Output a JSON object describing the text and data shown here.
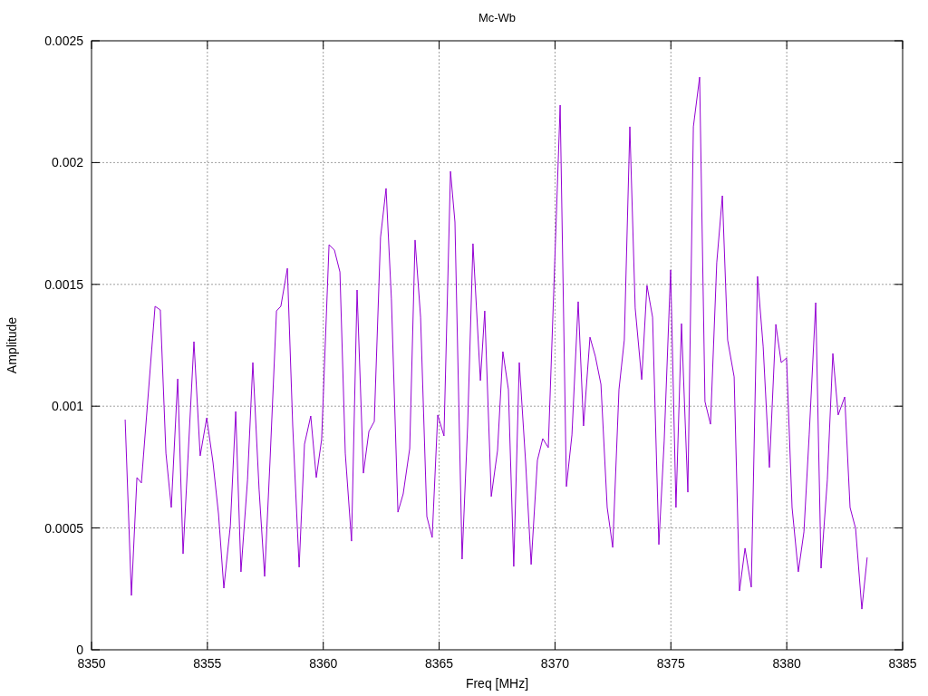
{
  "chart_data": {
    "type": "line",
    "title": "Mc-Wb",
    "xlabel": "Freq [MHz]",
    "ylabel": "Amplitude",
    "x": [
      8351.45,
      8351.72,
      8351.96,
      8352.15,
      8352.74,
      8352.97,
      8353.21,
      8353.44,
      8353.72,
      8353.95,
      8354.42,
      8354.69,
      8354.97,
      8355.24,
      8355.48,
      8355.71,
      8355.99,
      8356.22,
      8356.45,
      8356.73,
      8356.96,
      8357.23,
      8357.47,
      8357.7,
      8357.98,
      8358.17,
      8358.45,
      8358.68,
      8358.96,
      8359.19,
      8359.46,
      8359.7,
      8359.93,
      8360.25,
      8360.48,
      8360.72,
      8360.95,
      8361.22,
      8361.46,
      8361.73,
      8361.97,
      8362.2,
      8362.47,
      8362.71,
      8362.94,
      8363.22,
      8363.45,
      8363.73,
      8363.96,
      8364.2,
      8364.47,
      8364.7,
      8364.94,
      8365.21,
      8365.49,
      8365.68,
      8365.99,
      8366.23,
      8366.46,
      8366.78,
      8366.97,
      8367.25,
      8367.52,
      8367.75,
      8367.99,
      8368.22,
      8368.46,
      8368.73,
      8368.97,
      8369.24,
      8369.47,
      8369.71,
      8369.94,
      8370.22,
      8370.49,
      8370.73,
      8371.0,
      8371.23,
      8371.51,
      8371.74,
      8371.98,
      8372.25,
      8372.49,
      8372.76,
      8372.99,
      8373.23,
      8373.46,
      8373.74,
      8373.97,
      8374.21,
      8374.48,
      8374.71,
      8374.99,
      8375.22,
      8375.46,
      8375.73,
      8375.97,
      8376.24,
      8376.47,
      8376.71,
      8376.98,
      8377.22,
      8377.45,
      8377.73,
      8377.96,
      8378.2,
      8378.47,
      8378.74,
      8378.98,
      8379.25,
      8379.53,
      8379.76,
      8379.99,
      8380.23,
      8380.5,
      8380.74,
      8380.97,
      8381.25,
      8381.48,
      8381.75,
      8381.99,
      8382.22,
      8382.5,
      8382.73,
      8382.97,
      8383.24,
      8383.47
    ],
    "series": [
      {
        "color": "#9400d3",
        "values": [
          0.000945,
          0.000223,
          0.000707,
          0.000685,
          0.00141,
          0.001395,
          0.000807,
          0.000584,
          0.001112,
          0.000394,
          0.001265,
          0.000796,
          0.000952,
          0.00077,
          0.000558,
          0.000253,
          0.00051,
          0.000978,
          0.00032,
          0.000696,
          0.001179,
          0.000658,
          0.000301,
          0.00077,
          0.001391,
          0.00141,
          0.001566,
          0.000919,
          0.000339,
          0.000844,
          0.00096,
          0.000707,
          0.000863,
          0.001663,
          0.001641,
          0.001551,
          0.000807,
          0.000446,
          0.001477,
          0.000725,
          0.000897,
          0.000937,
          0.001693,
          0.001894,
          0.00144,
          0.000565,
          0.00064,
          0.000826,
          0.001682,
          0.001365,
          0.000547,
          0.000461,
          0.000964,
          0.000878,
          0.001964,
          0.001756,
          0.000372,
          0.000919,
          0.001667,
          0.001105,
          0.001391,
          0.000629,
          0.000818,
          0.001224,
          0.001068,
          0.000342,
          0.001179,
          0.00077,
          0.00035,
          0.000778,
          0.000867,
          0.00083,
          0.001458,
          0.002236,
          0.00067,
          0.000882,
          0.001429,
          0.000919,
          0.001283,
          0.001205,
          0.00109,
          0.000584,
          0.00042,
          0.001068,
          0.001272,
          0.002147,
          0.001403,
          0.001109,
          0.001496,
          0.001365,
          0.000432,
          0.000856,
          0.001559,
          0.000584,
          0.001339,
          0.000647,
          0.002147,
          0.002351,
          0.001019,
          0.000926,
          0.001589,
          0.001864,
          0.001272,
          0.00112,
          0.000242,
          0.000417,
          0.000257,
          0.001533,
          0.001246,
          0.000748,
          0.001336,
          0.001179,
          0.001198,
          0.000584,
          0.00032,
          0.000484,
          0.000882,
          0.001425,
          0.000335,
          0.000696,
          0.001216,
          0.000964,
          0.001038,
          0.000584,
          0.000498,
          0.000167,
          0.000379
        ]
      }
    ],
    "xlim": [
      8350,
      8385
    ],
    "ylim": [
      0,
      0.0025
    ],
    "xticks": [
      8350,
      8355,
      8360,
      8365,
      8370,
      8375,
      8380,
      8385
    ],
    "yticks": [
      0,
      0.0005,
      0.001,
      0.0015,
      0.002,
      0.0025
    ],
    "grid": true
  }
}
